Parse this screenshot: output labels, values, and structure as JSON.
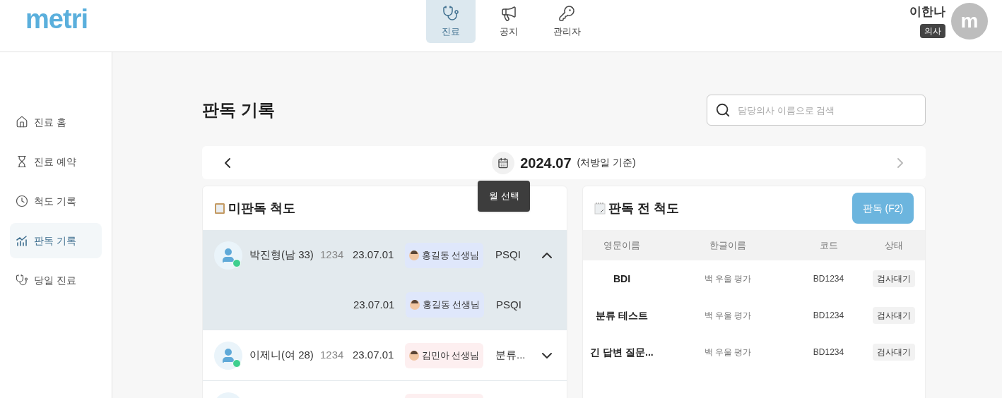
{
  "logo": "metri",
  "nav": [
    {
      "label": "진료",
      "selected": true
    },
    {
      "label": "공지",
      "selected": false
    },
    {
      "label": "관리자",
      "selected": false
    }
  ],
  "user": {
    "name": "이한나",
    "role": "의사",
    "avatar": "m"
  },
  "sidebar": {
    "items": [
      {
        "label": "진료 홈",
        "selected": false
      },
      {
        "label": "진료 예약",
        "selected": false
      },
      {
        "label": "척도 기록",
        "selected": false
      },
      {
        "label": "판독 기록",
        "selected": true
      },
      {
        "label": "당일 진료",
        "selected": false
      }
    ]
  },
  "page_title": "판독 기록",
  "search": {
    "placeholder": "담당의사 이름으로 검색"
  },
  "month_bar": {
    "month": "2024.07",
    "note": "(처방일 기준)",
    "tooltip": "월 선택"
  },
  "unread_panel": {
    "title": "미판독 척도",
    "rows": [
      {
        "kind": "patient",
        "name": "박진형(남 33)",
        "id": "1234",
        "date": "23.07.01",
        "doctor": "홍길동 선생님",
        "color": "#dfe7fb",
        "test": "PSQI",
        "expanded": true,
        "children": [
          {
            "date": "23.07.01",
            "doctor": "홍길동 선생님",
            "color": "#dfe7fb",
            "test": "PSQI"
          }
        ]
      },
      {
        "kind": "patient",
        "name": "이제니(여 28)",
        "id": "1234",
        "date": "23.07.01",
        "doctor": "김민아 선생님",
        "color": "#fdeff0",
        "test": "분류...",
        "expanded": false
      },
      {
        "kind": "partial",
        "color": "#fdeff0"
      }
    ]
  },
  "pending_panel": {
    "title": "판독 전 척도",
    "button": "판독 (F2)",
    "columns": [
      "영문이름",
      "한글이름",
      "코드",
      "상태"
    ],
    "rows": [
      {
        "english": "BDI",
        "korean": "백 우울 평가",
        "code": "BD1234",
        "status": "검사대기"
      },
      {
        "english": "분류 테스트",
        "korean": "백 우울 평가",
        "code": "BD1234",
        "status": "검사대기"
      },
      {
        "english": "긴 답변 질문...",
        "korean": "백 우울 평가",
        "code": "BD1234",
        "status": "검사대기"
      }
    ]
  }
}
